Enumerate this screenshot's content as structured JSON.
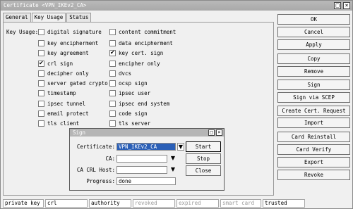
{
  "window": {
    "title": "Certificate <VPN_IKEv2_CA>"
  },
  "tabs": [
    "General",
    "Key Usage",
    "Status"
  ],
  "key_usage": {
    "label": "Key Usage:",
    "left": [
      {
        "label": "digital signature",
        "checked": false
      },
      {
        "label": "key encipherment",
        "checked": false
      },
      {
        "label": "key agreement",
        "checked": false
      },
      {
        "label": "crl sign",
        "checked": true
      },
      {
        "label": "decipher only",
        "checked": false
      },
      {
        "label": "server gated crypto",
        "checked": false
      },
      {
        "label": "timestamp",
        "checked": false
      },
      {
        "label": "ipsec tunnel",
        "checked": false
      },
      {
        "label": "email protect",
        "checked": false
      },
      {
        "label": "tls client",
        "checked": false
      }
    ],
    "right": [
      {
        "label": "content commitment",
        "checked": false
      },
      {
        "label": "data encipherment",
        "checked": false
      },
      {
        "label": "key cert. sign",
        "checked": true
      },
      {
        "label": "encipher only",
        "checked": false
      },
      {
        "label": "dvcs",
        "checked": false
      },
      {
        "label": "ocsp sign",
        "checked": false
      },
      {
        "label": "ipsec user",
        "checked": false
      },
      {
        "label": "ipsec end system",
        "checked": false
      },
      {
        "label": "code sign",
        "checked": false
      },
      {
        "label": "tls server",
        "checked": false
      }
    ]
  },
  "buttons": [
    "OK",
    "Cancel",
    "Apply",
    "Copy",
    "Remove",
    "Sign",
    "Sign via SCEP",
    "Create Cert. Request",
    "Import",
    "Card Reinstall",
    "Card Verify",
    "Export",
    "Revoke"
  ],
  "status_bar": [
    {
      "text": "private key",
      "dim": false
    },
    {
      "text": "crl",
      "dim": false
    },
    {
      "text": "authority",
      "dim": false
    },
    {
      "text": "revoked",
      "dim": true
    },
    {
      "text": "expired",
      "dim": true
    },
    {
      "text": "smart card",
      "dim": true
    },
    {
      "text": "trusted",
      "dim": false
    }
  ],
  "sign_dialog": {
    "title": "Sign",
    "certificate_label": "Certificate:",
    "certificate_value": "VPN_IKEv2_CA",
    "ca_label": "CA:",
    "ca_value": "",
    "crl_host_label": "CA CRL Host:",
    "crl_host_value": "",
    "progress_label": "Progress:",
    "progress_value": "done",
    "start_label": "Start",
    "stop_label": "Stop",
    "close_label": "Close"
  }
}
